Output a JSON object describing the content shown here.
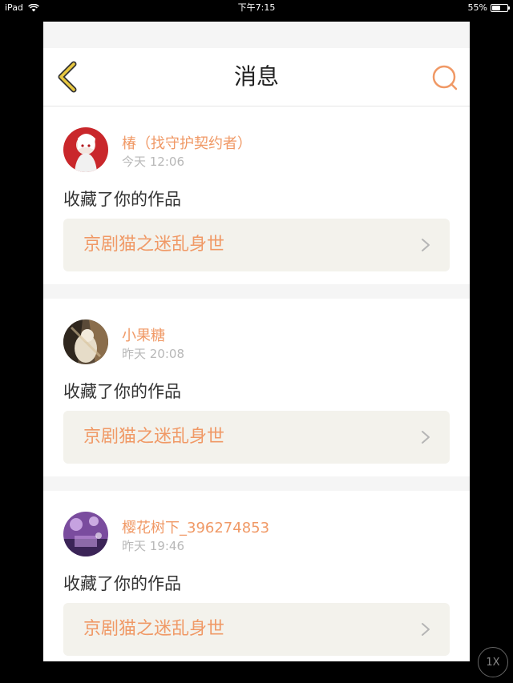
{
  "status": {
    "device": "iPad",
    "time": "下午7:15",
    "battery": "55%",
    "battery_level": 0.55
  },
  "nav": {
    "title": "消息"
  },
  "messages": [
    {
      "user": "椿（找守护契约者）",
      "time": "今天 12:06",
      "action": "收藏了你的作品",
      "work": "京剧猫之迷乱身世"
    },
    {
      "user": "小果糖",
      "time": "昨天 20:08",
      "action": "收藏了你的作品",
      "work": "京剧猫之迷乱身世"
    },
    {
      "user": "樱花树下_396274853",
      "time": "昨天 19:46",
      "action": "收藏了你的作品",
      "work": "京剧猫之迷乱身世"
    }
  ],
  "zoom": {
    "label": "1X"
  },
  "colors": {
    "accent": "#f09966",
    "back_icon": "#e8c840",
    "card_link_bg": "#f3f2ec"
  },
  "icons": {
    "back": "chevron-left-icon",
    "search": "search-icon",
    "link": "chevron-right-icon"
  }
}
